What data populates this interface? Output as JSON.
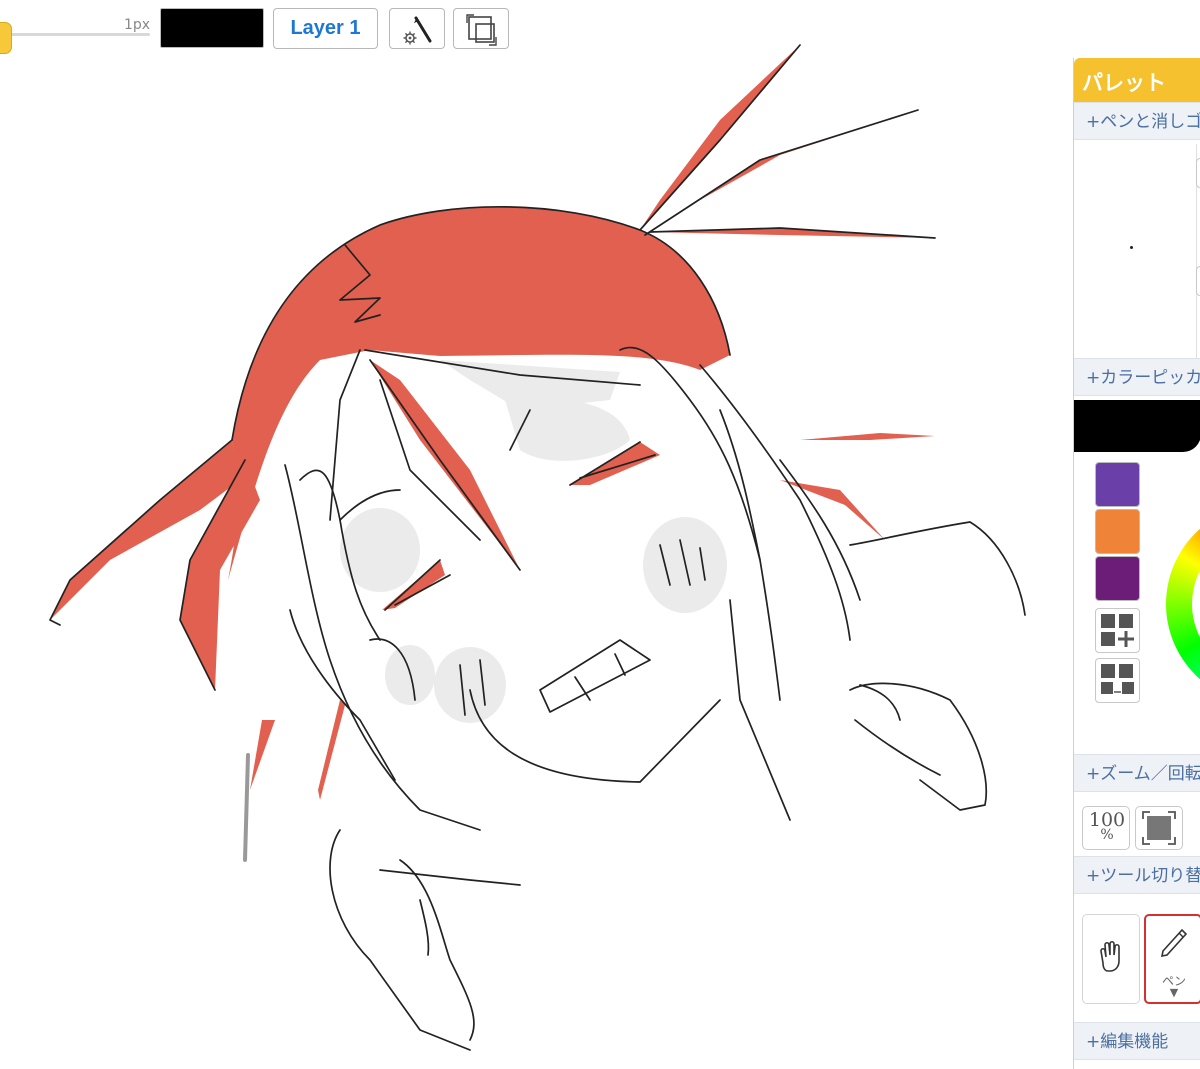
{
  "toolbar": {
    "brush_size": "1px",
    "brush_size_value": 1,
    "current_color": "#000000",
    "layer_label": "Layer 1",
    "brush_settings_icon": "brush-settings-icon",
    "transform_icon": "transform-icon"
  },
  "palette": {
    "title": "パレット",
    "header_color": "#f5c12e",
    "sections": {
      "pen_eraser": "+ペンと消しゴ",
      "color_picker": "+カラーピッカ",
      "zoom_rotate": "+ズーム／回転",
      "tool_switch": "+ツール切り替",
      "edit": "+編集機能"
    },
    "swatches": [
      "#6b3fa8",
      "#ef8338",
      "#6c1d78"
    ],
    "swatch_tools": [
      "add-swatch-icon",
      "swap-swatch-icon"
    ],
    "zoom": {
      "value": "100",
      "unit": "%",
      "fit_icon": "fit-screen-icon"
    },
    "tools": [
      {
        "name": "hand",
        "icon": "hand-icon",
        "label": ""
      },
      {
        "name": "pen",
        "icon": "pen-icon",
        "label": "ペン",
        "arrow": "▼",
        "selected": true
      }
    ]
  },
  "canvas": {
    "hair_color": "#e2604f",
    "shadow_color": "#ebebeb",
    "line_color": "#222222"
  }
}
